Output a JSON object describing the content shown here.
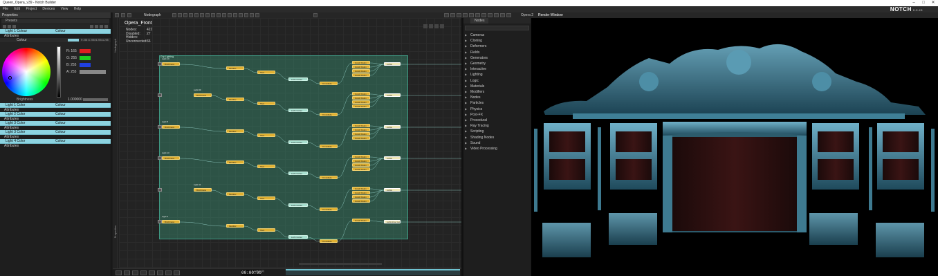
{
  "window": {
    "title": "Queen_Opera_v39 - Notch Builder",
    "controls": [
      "–",
      "□",
      "✕"
    ]
  },
  "menu": [
    "File",
    "Edit",
    "Project",
    "Devices",
    "View",
    "Help"
  ],
  "brand": {
    "logo": "NOTCH",
    "sub": "0.9.23"
  },
  "properties": {
    "title": "Properties",
    "presets": "Presets",
    "rows": [
      {
        "name": "Light 1 Colour",
        "type": "Colour",
        "expanded": true
      },
      {
        "name": "Light 1 Color",
        "type": "Colour"
      },
      {
        "name": "Light 2 Color",
        "type": "Colour"
      },
      {
        "name": "Light 3 Color",
        "type": "Colour"
      },
      {
        "name": "Light 3 Color",
        "type": "Colour"
      },
      {
        "name": "Light 4 Color",
        "type": "Colour"
      }
    ],
    "attributes": "Attributes",
    "colour_label": "Colour",
    "colour_value": "R 255 G 255 B 255 A 255",
    "channels": [
      {
        "label": "R: 165",
        "color": "#e02020"
      },
      {
        "label": "G: 255",
        "color": "#20d020"
      },
      {
        "label": "B: 255",
        "color": "#2040e0"
      },
      {
        "label": "A: 255",
        "color": "#888888"
      }
    ],
    "brightness": "Brightness",
    "brightness_value": "1.000000"
  },
  "nodegraph": {
    "tab": "Nodegraph",
    "title": "Opera_Front",
    "stats": [
      {
        "k": "Nodes:",
        "v": "422"
      },
      {
        "k": "Disabled:",
        "v": "27"
      },
      {
        "k": "Hidden:",
        "v": ""
      },
      {
        "k": "Unconnected:",
        "v": "66"
      }
    ],
    "group_label": "Grp Lighting",
    "side_labels": [
      "Nodegraph",
      "Properties"
    ],
    "rows": [
      {
        "light": "Light 10",
        "brightness": "Brightness",
        "modifier": "Modifier",
        "shot": "Shot",
        "colour": "Light Colour",
        "cross": "Crossfade",
        "ops": [
          "Graph Delay",
          "Graph Delay",
          "Graph Delay",
          "Graph Delay"
        ],
        "out": "Lights"
      },
      {
        "light": "Light 09",
        "brightness": "Brightness",
        "modifier": "Modifier",
        "shot": "Shot",
        "colour": "Light Colour",
        "cross": "Crossfade",
        "ops": [
          "Graph Delay",
          "Graph Delay",
          "Graph Delay",
          "Graph Delay"
        ],
        "out": "Lights"
      },
      {
        "light": "Light 8",
        "brightness": "Brightness",
        "modifier": "Modifier",
        "shot": "Shot",
        "colour": "Light Colour",
        "cross": "Crossfade",
        "ops": [
          "Graph Delay",
          "Graph Delay",
          "Graph Delay",
          "Graph Delay"
        ],
        "out": "Lights"
      },
      {
        "light": "Light 13",
        "brightness": "Brightness",
        "modifier": "Modifier",
        "shot": "Shot",
        "colour": "Light Colour",
        "cross": "Crossfade",
        "ops": [
          "Graph Delay",
          "Graph Delay",
          "Graph Delay",
          "Graph Delay"
        ],
        "out": "Lights"
      },
      {
        "light": "Light 11",
        "brightness": "Brightness",
        "modifier": "Modifier",
        "shot": "Shot",
        "colour": "Light Colour",
        "cross": "Crossfade",
        "ops": [
          "Graph Delay",
          "Graph Delay",
          "Graph Delay",
          "Graph Delay"
        ],
        "out": "Lights"
      },
      {
        "light": "Light 4",
        "brightness": "Brightness",
        "modifier": "Modifier",
        "shot": "Shot",
        "colour": "Light Colour",
        "cross": "Crossfade",
        "ops": [
          "Graph Delay"
        ],
        "out": "Light Array Lights"
      }
    ],
    "timecode": "00:00:00",
    "timeline_label": "Layer 1 (0)"
  },
  "nodes_panel": {
    "tab": "Nodes",
    "categories": [
      "Cameras",
      "Cloning",
      "Deformers",
      "Fields",
      "Generators",
      "Geometry",
      "Interactive",
      "Lighting",
      "Logic",
      "Materials",
      "Modifiers",
      "Nodes",
      "Particles",
      "Physics",
      "Post-FX",
      "Procedural",
      "Ray Tracing",
      "Scripting",
      "Shading Nodes",
      "Sound",
      "Video Processing"
    ]
  },
  "render": {
    "other_tab": "Opera 2",
    "title": "Render Window"
  }
}
